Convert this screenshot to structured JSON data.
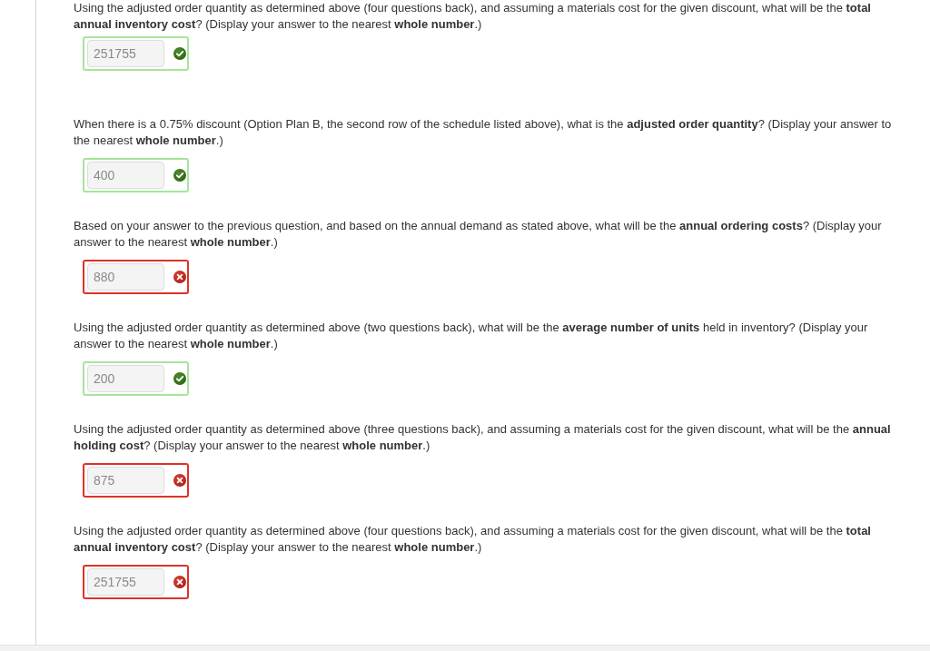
{
  "questions": [
    {
      "text": "Using the adjusted order quantity as determined above (four questions back), and assuming a materials cost for the given discount, what will be the **total annual inventory cost**? (Display your answer to the nearest **whole number**.)",
      "answer": "251755",
      "correct": true
    },
    {
      "text": "When there is a 0.75% discount (Option Plan B, the second row of the schedule listed above), what is the **adjusted order quantity**? (Display your answer to the nearest **whole number**.)",
      "answer": "400",
      "correct": true
    },
    {
      "text": "Based on your answer to the previous question, and based on the annual demand as stated above, what will be the **annual ordering costs**? (Display your answer to the nearest **whole number**.)",
      "answer": "880",
      "correct": false
    },
    {
      "text": "Using the adjusted order quantity as determined above (two questions back), what will be the **average number of units** held in inventory? (Display your answer to the nearest **whole number**.)",
      "answer": "200",
      "correct": true
    },
    {
      "text": "Using the adjusted order quantity as determined above (three questions back), and assuming a materials cost for the given discount, what will be the **annual holding cost**? (Display your answer to the nearest **whole number**.)",
      "answer": "875",
      "correct": false
    },
    {
      "text": "Using the adjusted order quantity as determined above (four questions back), and assuming a materials cost for the given discount, what will be the **total annual inventory cost**? (Display your answer to the nearest **whole number**.)",
      "answer": "251755",
      "correct": false
    }
  ]
}
